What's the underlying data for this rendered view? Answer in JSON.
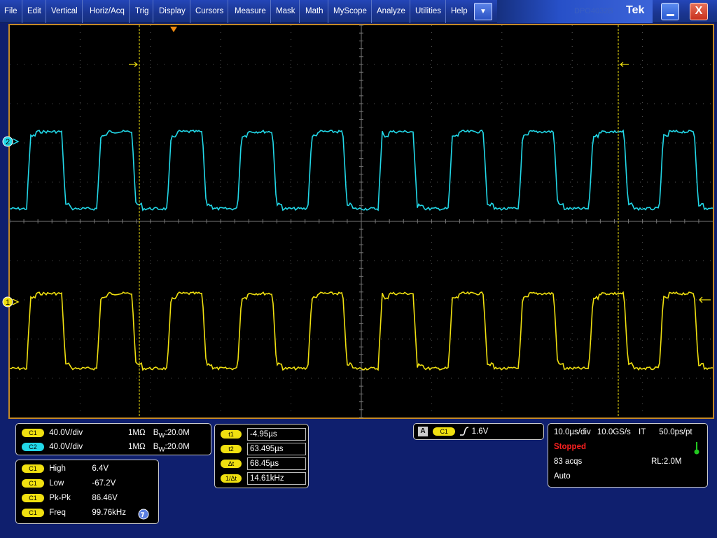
{
  "menu": {
    "items": [
      "File",
      "Edit",
      "Vertical",
      "Horiz/Acq",
      "Trig",
      "Display",
      "Cursors",
      "Measure",
      "Mask",
      "Math",
      "MyScope",
      "Analyze",
      "Utilities",
      "Help"
    ],
    "dropdown_icon": "chevron-down-icon",
    "brand_faint": "DPO4032B",
    "brand": "Tek",
    "minimize_icon": "minimize-icon",
    "close_label": "X"
  },
  "graticule": {
    "markers": {
      "ch2": "2",
      "ch1": "1"
    },
    "colors": {
      "ch1": "#f0e010",
      "ch2": "#22d8e8",
      "cursor": "#f0e010",
      "trigger": "#f08a10",
      "frame": "#c48a26"
    }
  },
  "channels": [
    {
      "badge": "C1",
      "scale": "40.0V/div",
      "impedance": "1MΩ",
      "bw_prefix": "B",
      "bw_sub": "W",
      "bw": ":20.0M"
    },
    {
      "badge": "C2",
      "scale": "40.0V/div",
      "impedance": "1MΩ",
      "bw_prefix": "B",
      "bw_sub": "W",
      "bw": ":20.0M"
    }
  ],
  "measurements": [
    {
      "badge": "C1",
      "name": "High",
      "value": "6.4V"
    },
    {
      "badge": "C1",
      "name": "Low",
      "value": "-67.2V"
    },
    {
      "badge": "C1",
      "name": "Pk-Pk",
      "value": "86.46V"
    },
    {
      "badge": "C1",
      "name": "Freq",
      "value": "99.76kHz"
    }
  ],
  "cursors": [
    {
      "label": "t1",
      "value": "-4.95µs"
    },
    {
      "label": "t2",
      "value": "63.495µs"
    },
    {
      "label": "Δt",
      "value": "68.45µs"
    },
    {
      "label": "1/Δt",
      "value": "14.61kHz"
    }
  ],
  "trigger": {
    "mode": "A",
    "source": "C1",
    "slope_icon": "rising-edge-icon",
    "level": "1.6V"
  },
  "acquisition": {
    "timebase": "10.0µs/div",
    "sample_rate": "10.0GS/s",
    "mode": "IT",
    "resolution": "50.0ps/pt",
    "status": "Stopped",
    "acqs": "83 acqs",
    "record_length": "RL:2.0M",
    "trigger_mode": "Auto",
    "status_color": "#ff2020"
  }
}
